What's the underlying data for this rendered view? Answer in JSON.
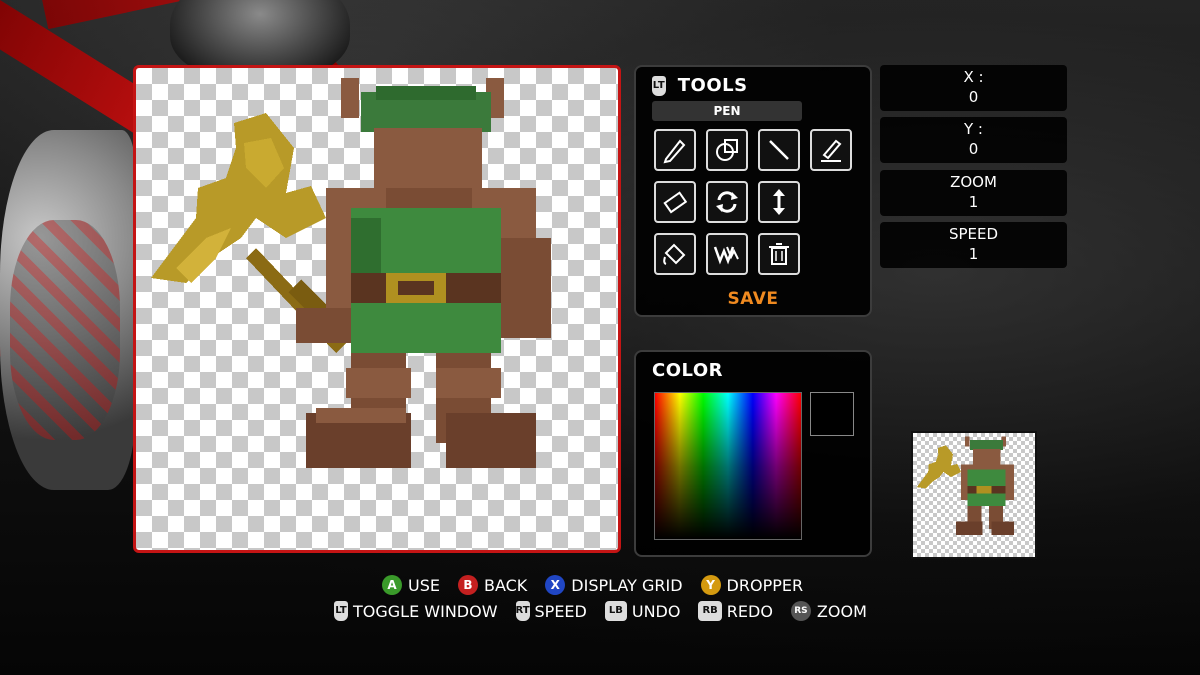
{
  "canvas_pixel_art": "dwarf-with-axe",
  "tools": {
    "title": "TOOLS",
    "mode": "PEN",
    "save_label": "SAVE",
    "buttons": [
      {
        "name": "pencil-tool-icon"
      },
      {
        "name": "shape-tool-icon"
      },
      {
        "name": "line-tool-icon"
      },
      {
        "name": "brush-tool-icon"
      },
      {
        "name": "eraser-tool-icon"
      },
      {
        "name": "rotate-tool-icon"
      },
      {
        "name": "flip-vertical-tool-icon"
      },
      {
        "name": "fill-bucket-tool-icon"
      },
      {
        "name": "wwe-logo-tool-icon"
      },
      {
        "name": "trash-tool-icon"
      }
    ]
  },
  "color": {
    "title": "COLOR",
    "selected_hex": "#000000"
  },
  "info": {
    "x_label": "X :",
    "x_value": "0",
    "y_label": "Y :",
    "y_value": "0",
    "zoom_label": "ZOOM",
    "zoom_value": "1",
    "speed_label": "SPEED",
    "speed_value": "1"
  },
  "controls": {
    "row1": [
      {
        "button": "A",
        "color": "#3a9a2a",
        "label": "USE"
      },
      {
        "button": "B",
        "color": "#c42020",
        "label": "BACK"
      },
      {
        "button": "X",
        "color": "#2046c4",
        "label": "DISPLAY GRID"
      },
      {
        "button": "Y",
        "color": "#d49a10",
        "label": "DROPPER"
      }
    ],
    "row2": [
      {
        "button": "LT",
        "label": "TOGGLE WINDOW"
      },
      {
        "button": "RT",
        "label": "SPEED"
      },
      {
        "button": "LB",
        "label": "UNDO"
      },
      {
        "button": "RB",
        "label": "REDO"
      },
      {
        "button": "RS",
        "label": "ZOOM"
      }
    ]
  },
  "colors": {
    "frame_red": "#c41414",
    "save_orange": "#f08a20"
  }
}
